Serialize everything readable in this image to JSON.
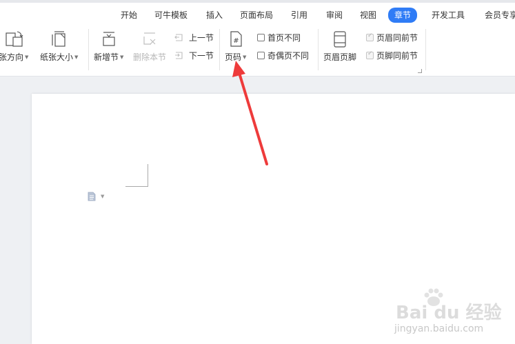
{
  "tabs": [
    {
      "label": "开始",
      "active": false
    },
    {
      "label": "可牛模板",
      "active": false
    },
    {
      "label": "插入",
      "active": false
    },
    {
      "label": "页面布局",
      "active": false
    },
    {
      "label": "引用",
      "active": false
    },
    {
      "label": "审阅",
      "active": false
    },
    {
      "label": "视图",
      "active": false
    },
    {
      "label": "章节",
      "active": true
    },
    {
      "label": "开发工具",
      "active": false
    },
    {
      "label": "会员专享",
      "active": false
    }
  ],
  "ribbon": {
    "paper_orientation": "张方向",
    "paper_size": "纸张大小",
    "new_section": "新增节",
    "delete_section": "删除本节",
    "prev_section": "上一节",
    "next_section": "下一节",
    "page_number": "页码",
    "first_page_different": "首页不同",
    "odd_even_different": "奇偶页不同",
    "header_footer": "页眉页脚",
    "header_same_as_prev": "页眉同前节",
    "footer_same_as_prev": "页脚同前节"
  },
  "colors": {
    "accent": "#2f7cf6",
    "arrow": "#ee3b3b"
  },
  "watermark": {
    "main": "Bai du 经验",
    "sub": "jingyan.baidu.com"
  }
}
